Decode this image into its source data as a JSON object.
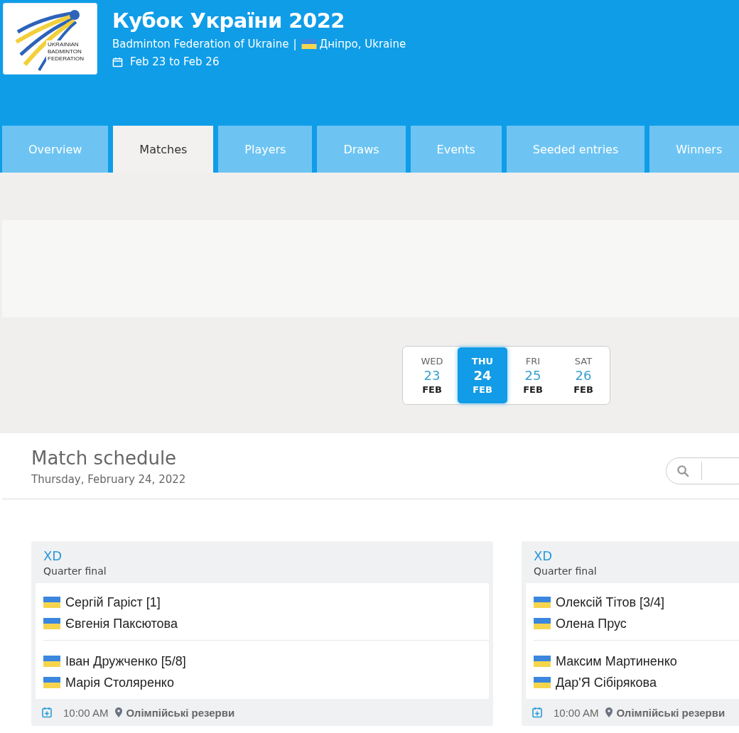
{
  "header": {
    "logo_lines": [
      "UKRAINIAN",
      "BADMINTON",
      "FEDERATION"
    ],
    "title": "Кубок України 2022",
    "organizer": "Badminton Federation of Ukraine",
    "separator": "|",
    "location": "Дніпро, Ukraine",
    "dates": "Feb 23 to Feb 26"
  },
  "tabs": [
    {
      "label": "Overview",
      "selected": false
    },
    {
      "label": "Matches",
      "selected": true
    },
    {
      "label": "Players",
      "selected": false
    },
    {
      "label": "Draws",
      "selected": false
    },
    {
      "label": "Events",
      "selected": false
    },
    {
      "label": "Seeded entries",
      "selected": false
    },
    {
      "label": "Winners",
      "selected": false
    }
  ],
  "days": [
    {
      "weekday": "WED",
      "day": "23",
      "month": "FEB",
      "selected": false
    },
    {
      "weekday": "THU",
      "day": "24",
      "month": "FEB",
      "selected": true
    },
    {
      "weekday": "FRI",
      "day": "25",
      "month": "FEB",
      "selected": false
    },
    {
      "weekday": "SAT",
      "day": "26",
      "month": "FEB",
      "selected": false
    }
  ],
  "schedule": {
    "title": "Match schedule",
    "subtitle": "Thursday, February 24, 2022"
  },
  "matches": [
    {
      "event": "XD",
      "round": "Quarter final",
      "teams": [
        [
          "Сергій Гаріст [1]",
          "Євгенія Паксютова"
        ],
        [
          "Іван Дружченко [5/8]",
          "Марія Столяренко"
        ]
      ],
      "time": "10:00 AM",
      "court": "Олімпійські резерви"
    },
    {
      "event": "XD",
      "round": "Quarter final",
      "teams": [
        [
          "Олексій Тітов [3/4]",
          "Олена Прус"
        ],
        [
          "Максим Мартиненко",
          "Дар'Я Сібірякова"
        ]
      ],
      "time": "10:00 AM",
      "court": "Олімпійські резерви"
    }
  ]
}
